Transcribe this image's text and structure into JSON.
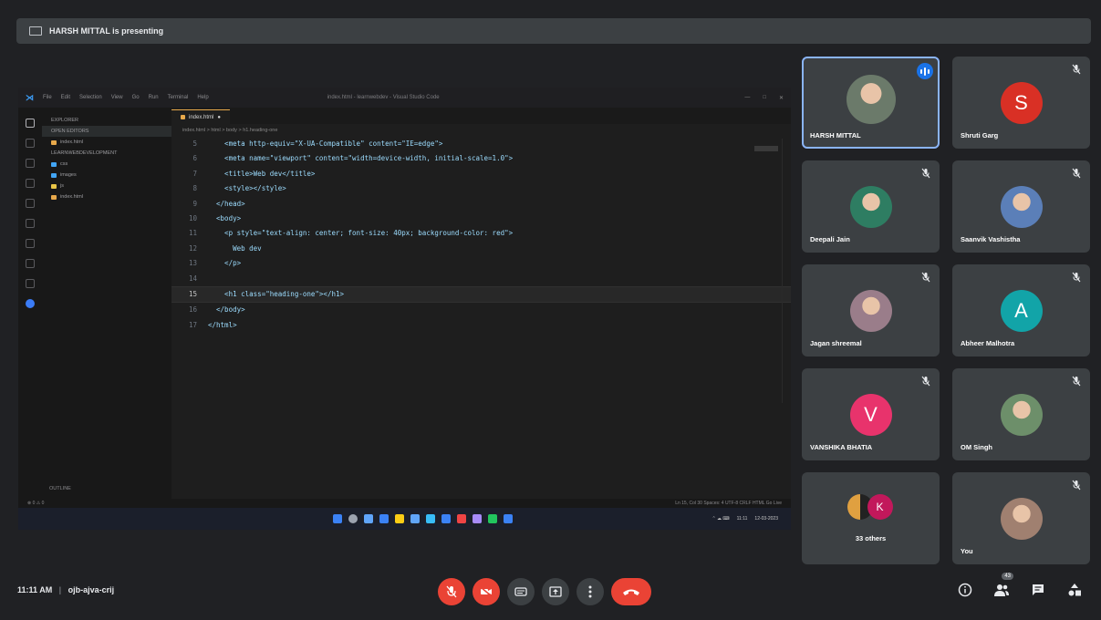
{
  "presenting": {
    "text": "HARSH MITTAL is presenting"
  },
  "vscode": {
    "title_menu": [
      "File",
      "Edit",
      "Selection",
      "View",
      "Go",
      "Run",
      "Terminal",
      "Help"
    ],
    "window_title": "index.html - learnwebdev - Visual Studio Code",
    "explorer_header": "EXPLORER",
    "open_editors": "OPEN EDITORS",
    "project": "LEARNWEBDEVELOPMENT",
    "files": [
      "index.html",
      "css",
      "images",
      "js",
      "index.html"
    ],
    "outline": "OUTLINE",
    "tab_name": "index.html",
    "breadcrumb": "index.html > html > body > h1.heading-one",
    "code_lines": [
      {
        "n": "5",
        "text": "    <meta http-equiv=\"X-UA-Compatible\" content=\"IE=edge\">"
      },
      {
        "n": "6",
        "text": "    <meta name=\"viewport\" content=\"width=device-width, initial-scale=1.0\">"
      },
      {
        "n": "7",
        "text": "    <title>Web dev</title>"
      },
      {
        "n": "8",
        "text": "    <style></style>"
      },
      {
        "n": "9",
        "text": "  </head>"
      },
      {
        "n": "10",
        "text": "  <body>"
      },
      {
        "n": "11",
        "text": "    <p style=\"text-align: center; font-size: 40px; background-color: red\">"
      },
      {
        "n": "12",
        "text": "      Web dev"
      },
      {
        "n": "13",
        "text": "    </p>"
      },
      {
        "n": "14",
        "text": ""
      },
      {
        "n": "15",
        "text": "    <h1 class=\"heading-one\"></h1>"
      },
      {
        "n": "16",
        "text": "  </body>"
      },
      {
        "n": "17",
        "text": "</html>"
      }
    ],
    "current_line": "15",
    "status_left": "⊗ 0 ⚠ 0",
    "status_right": "Ln 15, Col 30   Spaces: 4   UTF-8   CRLF   HTML   Go Live",
    "tray_time": "11:11",
    "tray_date": "12-03-2023"
  },
  "participants": [
    {
      "name": "HARSH MITTAL",
      "type": "photo",
      "speaking": true,
      "muted": false,
      "color": "#6b7a6a"
    },
    {
      "name": "Shruti Garg",
      "type": "letter",
      "letter": "S",
      "color": "#d93025",
      "muted": true
    },
    {
      "name": "Deepali Jain",
      "type": "photo",
      "color": "#2e7d62",
      "muted": true
    },
    {
      "name": "Saanvik Vashistha",
      "type": "photo",
      "color": "#5b7fb8",
      "muted": true
    },
    {
      "name": "Jagan shreemal",
      "type": "photo",
      "color": "#9a7d8a",
      "muted": true
    },
    {
      "name": "Abheer Malhotra",
      "type": "letter",
      "letter": "A",
      "color": "#12a4a8",
      "muted": true
    },
    {
      "name": "VANSHIKA BHATIA",
      "type": "letter",
      "letter": "V",
      "color": "#e8336c",
      "muted": true
    },
    {
      "name": "OM Singh",
      "type": "photo",
      "color": "#6d8f6a",
      "muted": true
    },
    {
      "name": "33 others",
      "type": "others",
      "letter": "K",
      "color": "#c2185b",
      "muted": false
    },
    {
      "name": "You",
      "type": "photo",
      "color": "#a08070",
      "muted": true
    }
  ],
  "footer": {
    "time": "11:11 AM",
    "separator": "|",
    "meeting_code": "ojb-ajva-crij",
    "people_count": "43"
  },
  "colors": {
    "danger": "#ea4335",
    "control": "#3c4043",
    "tile": "#3c4043",
    "highlight": "#8ab4f8"
  }
}
